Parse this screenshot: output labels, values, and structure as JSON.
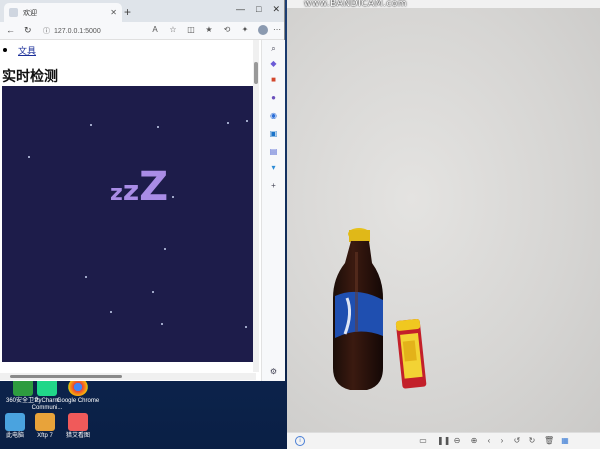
{
  "browser": {
    "tab_title": "欢迎",
    "url": "127.0.0.1:5000",
    "window_controls": [
      "—",
      "□",
      "✕"
    ]
  },
  "page": {
    "link_text": "文具",
    "heading": "实时检测",
    "canvas_text": "zzZ"
  },
  "desktop": {
    "icons": [
      {
        "label": "360安全卫士",
        "color": "#2e9c3f"
      },
      {
        "label": "PyCharm Communi...",
        "color": "#21d789"
      },
      {
        "label": "Google Chrome",
        "color": "#e84335"
      },
      {
        "label": "此电脑",
        "color": "#4aa3df"
      },
      {
        "label": "Xftp 7",
        "color": "#e8a33a"
      },
      {
        "label": "猎艾看图",
        "color": "#f05a5a"
      }
    ]
  },
  "viewer": {
    "watermark": "www.BANDICAM.com"
  }
}
